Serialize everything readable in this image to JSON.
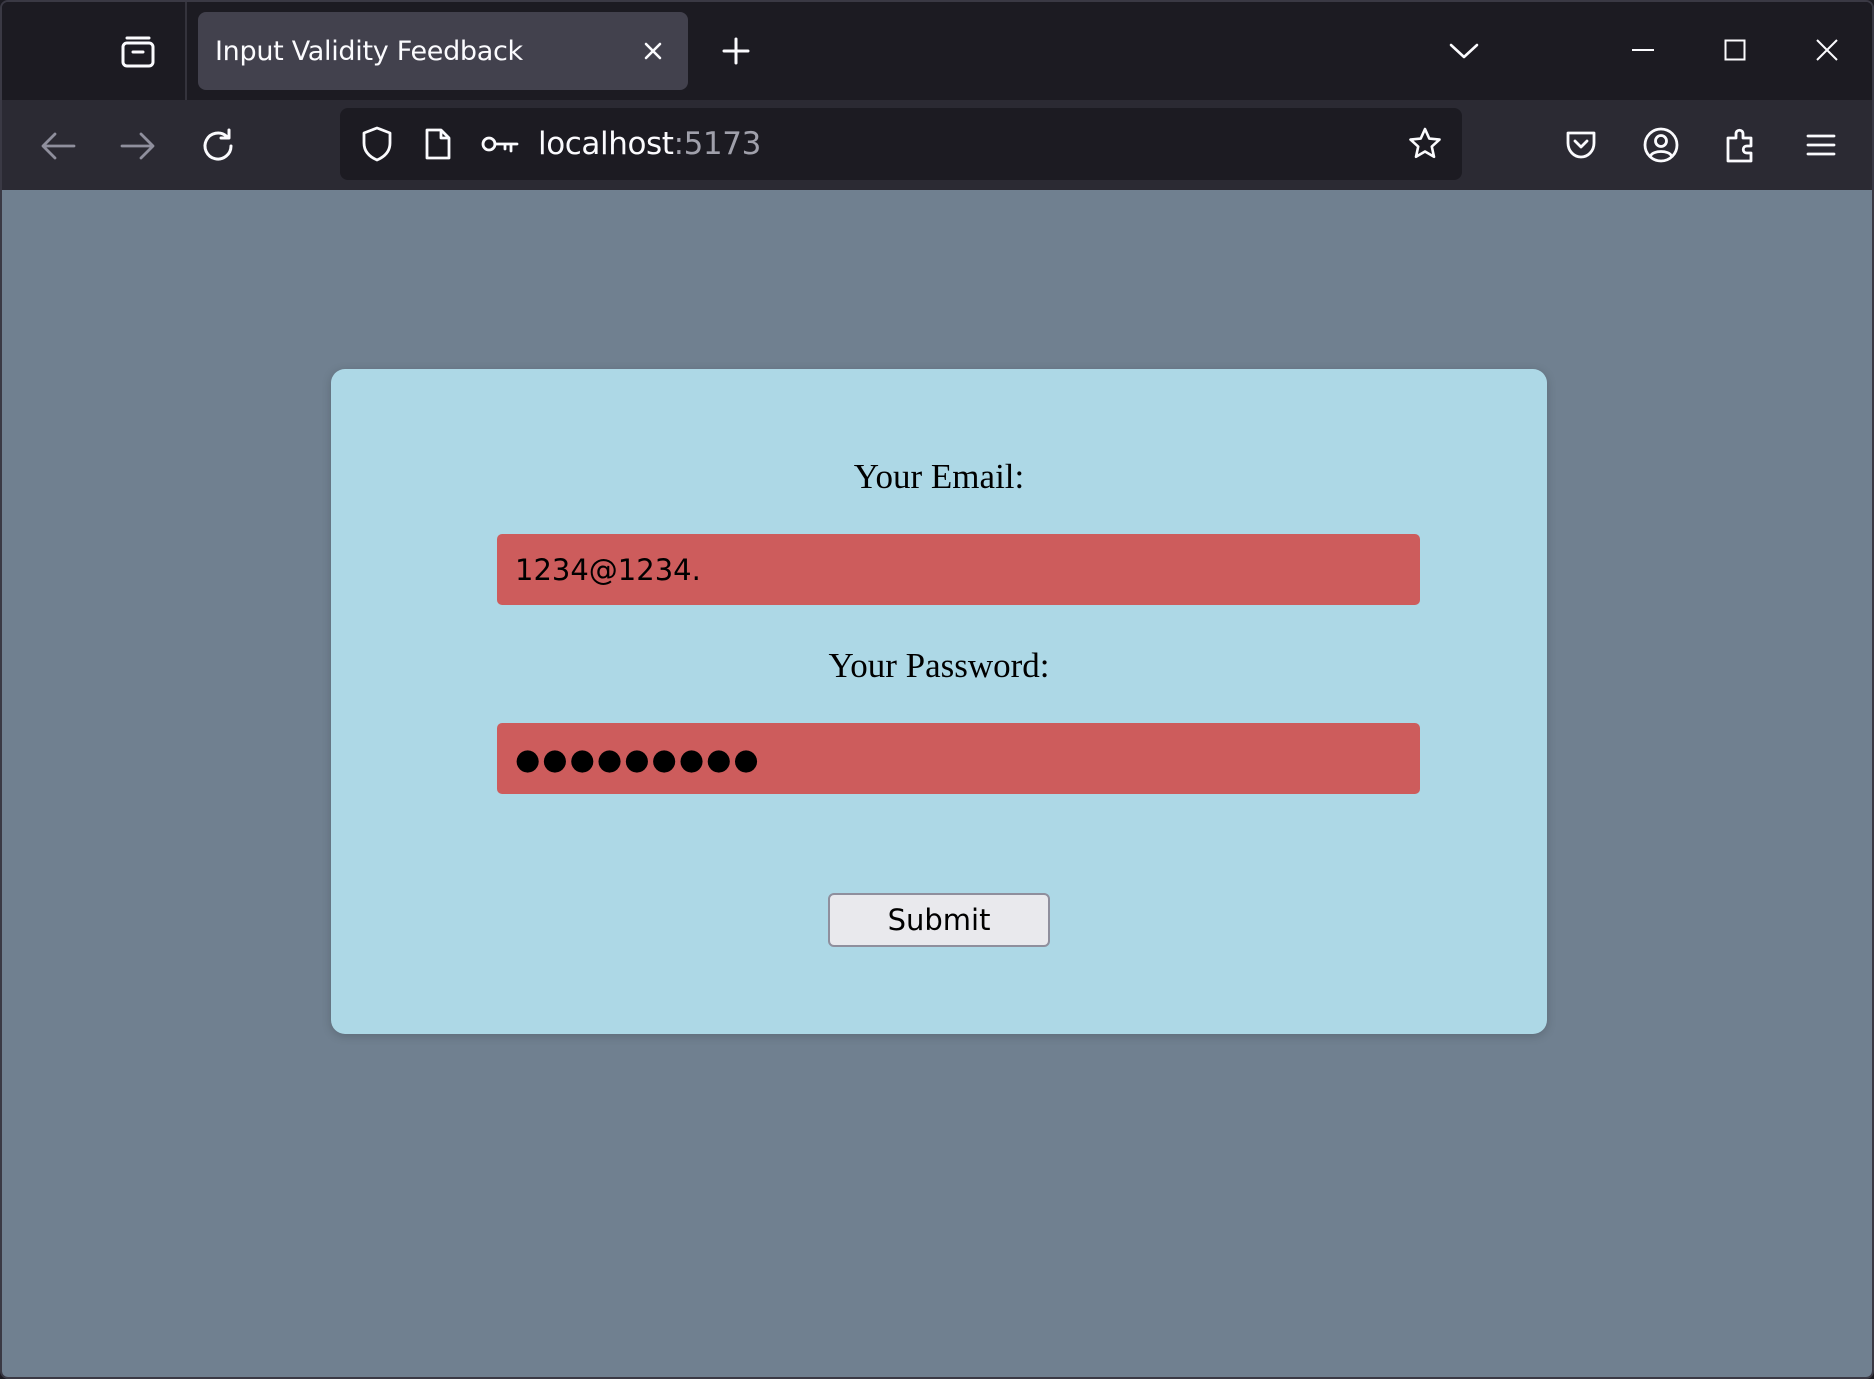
{
  "browser": {
    "tab": {
      "title": "Input Validity Feedback"
    },
    "url": {
      "host": "localhost",
      "port": ":5173"
    },
    "icons": {
      "overview": "tab-overview-icon",
      "close": "close-icon",
      "new_tab": "plus-icon",
      "tab_list": "chevron-down-icon",
      "back": "back-arrow-icon",
      "forward": "forward-arrow-icon",
      "reload": "reload-icon",
      "shield": "shield-icon",
      "page": "page-icon",
      "key": "key-icon",
      "star": "star-icon",
      "pocket": "pocket-icon",
      "account": "account-icon",
      "extensions": "puzzle-icon",
      "menu": "hamburger-menu-icon"
    }
  },
  "form": {
    "email_label": "Your Email:",
    "email_value": "1234@1234.",
    "password_label": "Your Password:",
    "password_masked": "●●●●●●●●●",
    "submit_label": "Submit"
  },
  "colors": {
    "page_bg": "#708090",
    "card_bg": "#add8e6",
    "invalid_field_bg": "#cd5c5c"
  }
}
